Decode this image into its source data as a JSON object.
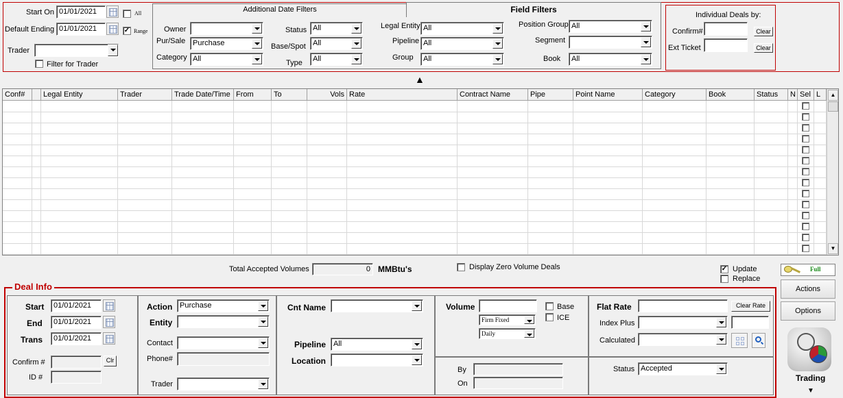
{
  "filters": {
    "start_on_label": "Start On",
    "start_on_value": "01/01/2021",
    "all_label": "All",
    "default_ending_label": "Default Ending",
    "default_ending_value": "01/01/2021",
    "range_label": "Range",
    "range_checked": "✓",
    "trader_label": "Trader",
    "trader_value": "",
    "filter_for_trader_label": "Filter for Trader"
  },
  "tabs": {
    "additional_date_filters": "Additional Date Filters",
    "field_filters": "Field Filters"
  },
  "field_filters": {
    "owner_label": "Owner",
    "owner_value": "",
    "pursale_label": "Pur/Sale",
    "pursale_value": "Purchase",
    "category_label": "Category",
    "category_value": "All",
    "status_label": "Status",
    "status_value": "All",
    "basespot_label": "Base/Spot",
    "basespot_value": "All",
    "type_label": "Type",
    "type_value": "All",
    "legal_entity_label": "Legal Entity",
    "legal_entity_value": "All",
    "pipeline_label": "Pipeline",
    "pipeline_value": "All",
    "group_label": "Group",
    "group_value": "All",
    "position_group_label": "Position Group",
    "position_group_value": "All",
    "segment_label": "Segment",
    "segment_value": "",
    "book_label": "Book",
    "book_value": "All"
  },
  "individual": {
    "title": "Individual Deals by:",
    "confirm_label": "Confirm#",
    "ext_ticket_label": "Ext Ticket",
    "clear_label": "Clear"
  },
  "collapse_glyph": "▲",
  "grid": {
    "columns": [
      "Conf#",
      "",
      "Legal Entity",
      "Trader",
      "Trade Date/Time",
      "From",
      "To",
      "Vols",
      "Rate",
      "Contract Name",
      "Pipe",
      "Point Name",
      "Category",
      "Book",
      "Status",
      "N",
      "Sel",
      "L"
    ],
    "row_count": 14
  },
  "totals": {
    "label": "Total Accepted Volumes",
    "value": "0",
    "unit": "MMBtu's",
    "display_zero_label": "Display Zero Volume Deals",
    "update_label": "Update",
    "update_checked": "✓",
    "replace_label": "Replace",
    "full_label": "Full"
  },
  "side_buttons": {
    "actions": "Actions",
    "options": "Options",
    "trading": "Trading",
    "down_glyph": "▼"
  },
  "deal_info": {
    "title": "Deal Info",
    "start_label": "Start",
    "start_value": "01/01/2021",
    "end_label": "End",
    "end_value": "01/01/2021",
    "trans_label": "Trans",
    "trans_value": "01/01/2021",
    "confirm_label": "Confirm #",
    "clr_label": "Clr",
    "id_label": "ID #",
    "action_label": "Action",
    "action_value": "Purchase",
    "entity_label": "Entity",
    "entity_value": "",
    "contact_label": "Contact",
    "contact_value": "",
    "phone_label": "Phone#",
    "trader_label": "Trader",
    "trader_value": "",
    "cnt_name_label": "Cnt Name",
    "cnt_name_value": "",
    "pipeline_label": "Pipeline",
    "pipeline_value": "All",
    "location_label": "Location",
    "location_value": "",
    "volume_label": "Volume",
    "firm_value": "Firm Fixed",
    "freq_value": "Daily",
    "base_label": "Base",
    "ice_label": "ICE",
    "by_label": "By",
    "on_label": "On",
    "flat_rate_label": "Flat Rate",
    "clear_rate_label": "Clear Rate",
    "index_plus_label": "Index Plus",
    "calculated_label": "Calculated",
    "status_label": "Status",
    "status_value": "Accepted"
  }
}
